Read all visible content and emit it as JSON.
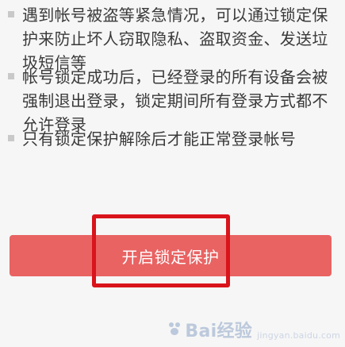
{
  "items": [
    {
      "text": "遇到帐号被盗等紧急情况，可以通过锁定保护来防止坏人窃取隐私、盗取资金、发送垃圾短信等"
    },
    {
      "text": "帐号锁定成功后，已经登录的所有设备会被强制退出登录，锁定期间所有登录方式都不允许登录"
    },
    {
      "text": "只有锁定保护解除后才能正常登录帐号"
    }
  ],
  "button": {
    "label": "开启锁定保护"
  },
  "watermark": {
    "brand": "Bai经验",
    "sub": "jingyan.baidu.com"
  },
  "colors": {
    "button_bg": "#e96363",
    "highlight": "#d9141b"
  }
}
